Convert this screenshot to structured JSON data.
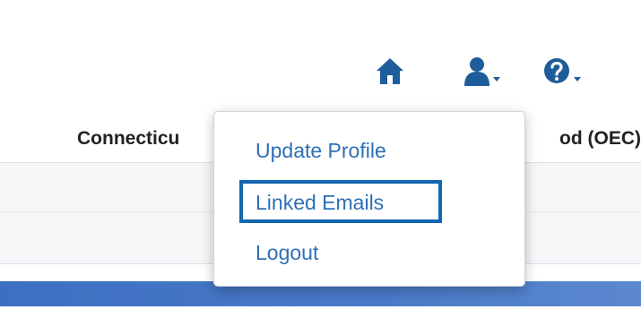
{
  "header": {
    "icons": [
      "home-icon",
      "user-icon",
      "help-icon"
    ]
  },
  "org_title": {
    "left_fragment": "Connecticu",
    "right_fragment": "od (OEC)"
  },
  "user_menu": {
    "items": [
      {
        "label": "Update Profile"
      },
      {
        "label": "Linked Emails",
        "highlighted": true
      },
      {
        "label": "Logout"
      }
    ]
  },
  "colors": {
    "link": "#2f6fb5",
    "icon": "#1f5d9a",
    "highlight_border": "#1466b0",
    "bar": "#4a7ac8"
  }
}
